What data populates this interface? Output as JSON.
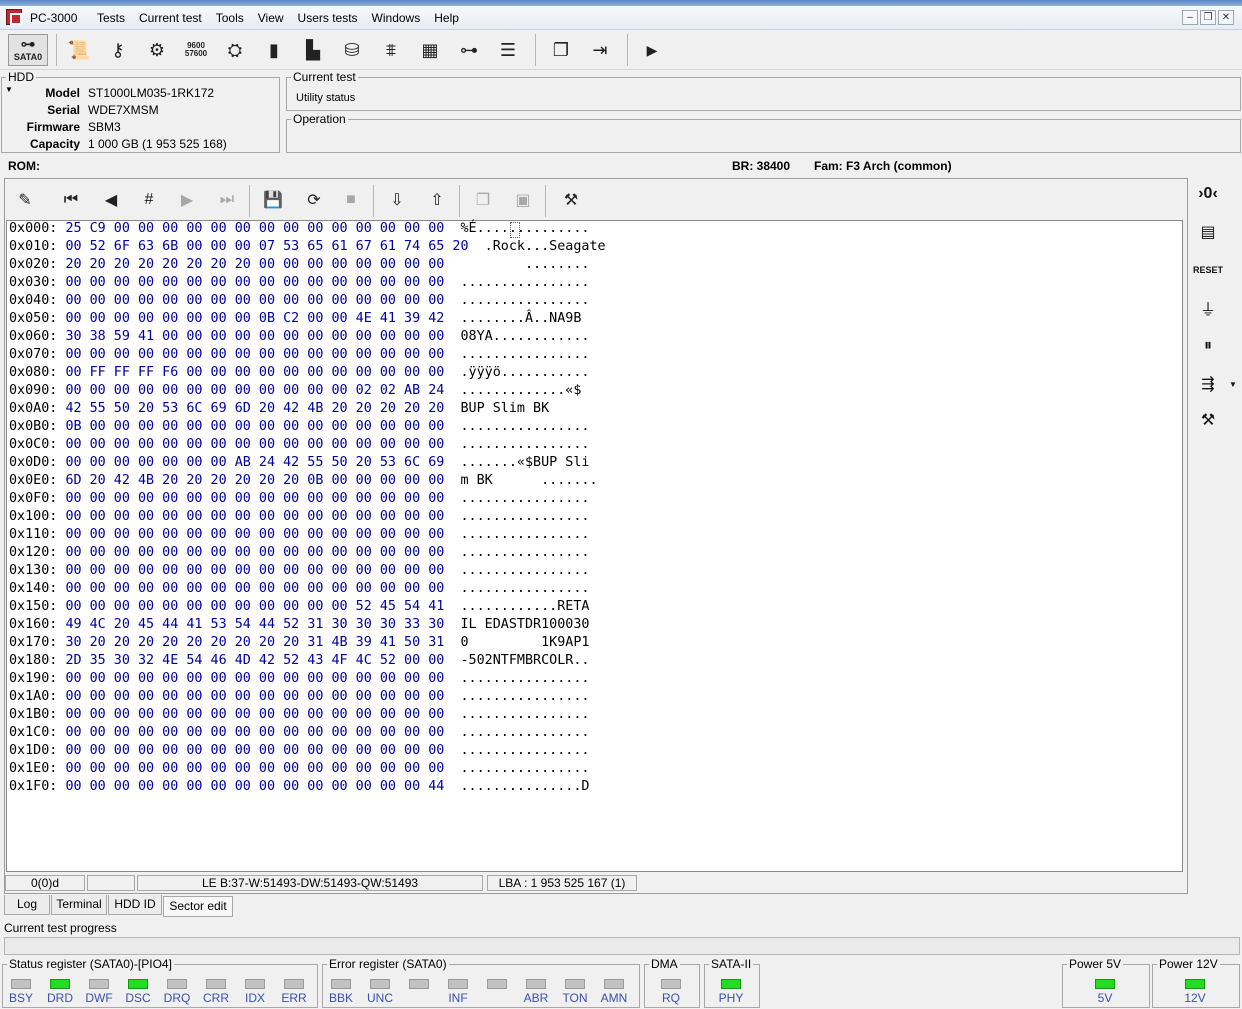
{
  "app": {
    "title": "PC-3000"
  },
  "menu": [
    "Tests",
    "Current test",
    "Tools",
    "View",
    "Users tests",
    "Windows",
    "Help"
  ],
  "toolbar": {
    "sata_label": "SATA0"
  },
  "hdd": {
    "group_label": "HDD",
    "rows": [
      {
        "k": "Model",
        "v": "ST1000LM035-1RK172"
      },
      {
        "k": "Serial",
        "v": "WDE7XMSM"
      },
      {
        "k": "Firmware",
        "v": "SBM3"
      },
      {
        "k": "Capacity",
        "v": "1 000 GB (1 953 525 168)"
      }
    ]
  },
  "current_test": {
    "label": "Current test",
    "value": "Utility status"
  },
  "operation": {
    "label": "Operation",
    "value": ""
  },
  "rom": {
    "label": "ROM:",
    "br": "BR: 38400",
    "fam": "Fam: F3 Arch (common)"
  },
  "hex": [
    {
      "a": "0x000:",
      "b": "25 C9 00 00 00 00 00 00 00 00 00 00 00 00 00 00",
      "t": "%É.............."
    },
    {
      "a": "0x010:",
      "b": "00 52 6F 63 6B 00 00 00 07 53 65 61 67 61 74 65 20",
      "t": ".Rock...Seagate"
    },
    {
      "a": "0x020:",
      "b": "20 20 20 20 20 20 20 20 00 00 00 00 00 00 00 00",
      "t": "        ........"
    },
    {
      "a": "0x030:",
      "b": "00 00 00 00 00 00 00 00 00 00 00 00 00 00 00 00",
      "t": "................"
    },
    {
      "a": "0x040:",
      "b": "00 00 00 00 00 00 00 00 00 00 00 00 00 00 00 00",
      "t": "................"
    },
    {
      "a": "0x050:",
      "b": "00 00 00 00 00 00 00 00 0B C2 00 00 4E 41 39 42",
      "t": "........Â..NA9B"
    },
    {
      "a": "0x060:",
      "b": "30 38 59 41 00 00 00 00 00 00 00 00 00 00 00 00",
      "t": "08YA............"
    },
    {
      "a": "0x070:",
      "b": "00 00 00 00 00 00 00 00 00 00 00 00 00 00 00 00",
      "t": "................"
    },
    {
      "a": "0x080:",
      "b": "00 FF FF FF F6 00 00 00 00 00 00 00 00 00 00 00",
      "t": ".ÿÿÿö..........."
    },
    {
      "a": "0x090:",
      "b": "00 00 00 00 00 00 00 00 00 00 00 00 02 02 AB 24",
      "t": ".............«$"
    },
    {
      "a": "0x0A0:",
      "b": "42 55 50 20 53 6C 69 6D 20 42 4B 20 20 20 20 20",
      "t": "BUP Slim BK"
    },
    {
      "a": "0x0B0:",
      "b": "0B 00 00 00 00 00 00 00 00 00 00 00 00 00 00 00",
      "t": "................"
    },
    {
      "a": "0x0C0:",
      "b": "00 00 00 00 00 00 00 00 00 00 00 00 00 00 00 00",
      "t": "................"
    },
    {
      "a": "0x0D0:",
      "b": "00 00 00 00 00 00 00 AB 24 42 55 50 20 53 6C 69",
      "t": ".......«$BUP Sli"
    },
    {
      "a": "0x0E0:",
      "b": "6D 20 42 4B 20 20 20 20 20 20 0B 00 00 00 00 00",
      "t": "m BK      ......."
    },
    {
      "a": "0x0F0:",
      "b": "00 00 00 00 00 00 00 00 00 00 00 00 00 00 00 00",
      "t": "................"
    },
    {
      "a": "0x100:",
      "b": "00 00 00 00 00 00 00 00 00 00 00 00 00 00 00 00",
      "t": "................"
    },
    {
      "a": "0x110:",
      "b": "00 00 00 00 00 00 00 00 00 00 00 00 00 00 00 00",
      "t": "................"
    },
    {
      "a": "0x120:",
      "b": "00 00 00 00 00 00 00 00 00 00 00 00 00 00 00 00",
      "t": "................"
    },
    {
      "a": "0x130:",
      "b": "00 00 00 00 00 00 00 00 00 00 00 00 00 00 00 00",
      "t": "................"
    },
    {
      "a": "0x140:",
      "b": "00 00 00 00 00 00 00 00 00 00 00 00 00 00 00 00",
      "t": "................"
    },
    {
      "a": "0x150:",
      "b": "00 00 00 00 00 00 00 00 00 00 00 00 52 45 54 41",
      "t": "............RETA"
    },
    {
      "a": "0x160:",
      "b": "49 4C 20 45 44 41 53 54 44 52 31 30 30 30 33 30",
      "t": "IL EDASTDR100030"
    },
    {
      "a": "0x170:",
      "b": "30 20 20 20 20 20 20 20 20 20 31 4B 39 41 50 31",
      "t": "0         1K9AP1"
    },
    {
      "a": "0x180:",
      "b": "2D 35 30 32 4E 54 46 4D 42 52 43 4F 4C 52 00 00",
      "t": "-502NTFMBRCOLR.."
    },
    {
      "a": "0x190:",
      "b": "00 00 00 00 00 00 00 00 00 00 00 00 00 00 00 00",
      "t": "................"
    },
    {
      "a": "0x1A0:",
      "b": "00 00 00 00 00 00 00 00 00 00 00 00 00 00 00 00",
      "t": "................"
    },
    {
      "a": "0x1B0:",
      "b": "00 00 00 00 00 00 00 00 00 00 00 00 00 00 00 00",
      "t": "................"
    },
    {
      "a": "0x1C0:",
      "b": "00 00 00 00 00 00 00 00 00 00 00 00 00 00 00 00",
      "t": "................"
    },
    {
      "a": "0x1D0:",
      "b": "00 00 00 00 00 00 00 00 00 00 00 00 00 00 00 00",
      "t": "................"
    },
    {
      "a": "0x1E0:",
      "b": "00 00 00 00 00 00 00 00 00 00 00 00 00 00 00 00",
      "t": "................"
    },
    {
      "a": "0x1F0:",
      "b": "00 00 00 00 00 00 00 00 00 00 00 00 00 00 00 44",
      "t": "...............D"
    }
  ],
  "status_boxes": {
    "offset": "0(0)d",
    "le": "LE B:37-W:51493-DW:51493-QW:51493",
    "lba": "LBA : 1 953 525 167 (1)"
  },
  "tabs": [
    {
      "label": "Log"
    },
    {
      "label": "Terminal"
    },
    {
      "label": "HDD ID"
    },
    {
      "label": "Sector edit"
    }
  ],
  "progress": {
    "label": "Current test progress",
    "value": 0
  },
  "status_register": {
    "label": "Status register (SATA0)-[PIO4]",
    "leds": [
      {
        "n": "BSY",
        "on": false
      },
      {
        "n": "DRD",
        "on": true
      },
      {
        "n": "DWF",
        "on": false
      },
      {
        "n": "DSC",
        "on": true
      },
      {
        "n": "DRQ",
        "on": false
      },
      {
        "n": "CRR",
        "on": false
      },
      {
        "n": "IDX",
        "on": false
      },
      {
        "n": "ERR",
        "on": false
      }
    ]
  },
  "error_register": {
    "label": "Error register (SATA0)",
    "leds": [
      {
        "n": "BBK",
        "on": false
      },
      {
        "n": "UNC",
        "on": false
      },
      {
        "n": "",
        "on": false
      },
      {
        "n": "INF",
        "on": false
      },
      {
        "n": "",
        "on": false
      },
      {
        "n": "ABR",
        "on": false
      },
      {
        "n": "TON",
        "on": false
      },
      {
        "n": "AMN",
        "on": false
      }
    ]
  },
  "dma": {
    "label": "DMA",
    "leds": [
      {
        "n": "RQ",
        "on": false
      }
    ]
  },
  "sata2": {
    "label": "SATA-II",
    "leds": [
      {
        "n": "PHY",
        "on": true
      }
    ]
  },
  "power5": {
    "label": "Power 5V",
    "leds": [
      {
        "n": "5V",
        "on": true
      }
    ]
  },
  "power12": {
    "label": "Power 12V",
    "leds": [
      {
        "n": "12V",
        "on": true
      }
    ]
  },
  "colors": {
    "led_on": "#22dd22",
    "led_off": "#c2c2c2",
    "hex_bytes": "#0000a0",
    "led_label": "#3a4fb0"
  }
}
